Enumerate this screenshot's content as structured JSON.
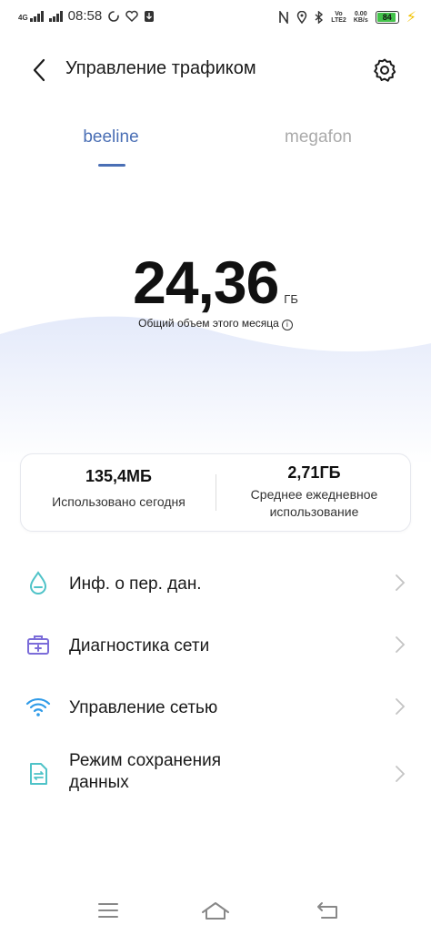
{
  "status_bar": {
    "network": "4G",
    "time": "08:58",
    "volte": "Vo‘\nLTE2",
    "speed": "0.00\nKB/s",
    "battery_level": "84",
    "battery_fraction": 0.84
  },
  "header": {
    "title": "Управление трафиком"
  },
  "tabs": [
    {
      "label": "beeline",
      "active": true
    },
    {
      "label": "megafon",
      "active": false
    }
  ],
  "usage": {
    "value": "24,36",
    "unit": "ГБ",
    "caption": "Общий объем этого месяца"
  },
  "stats": {
    "today_value": "135,4МБ",
    "today_label": "Использовано сегодня",
    "avg_value": "2,71ГБ",
    "avg_label_line1": "Среднее ежедневное",
    "avg_label_line2": "использование"
  },
  "menu": {
    "items": [
      {
        "label": "Инф. о пер. дан.",
        "icon": "drop-icon"
      },
      {
        "label": "Диагностика сети",
        "icon": "medkit-icon"
      },
      {
        "label": "Управление сетью",
        "icon": "wifi-icon"
      },
      {
        "label_line1": "Режим сохранения",
        "label_line2": "данных",
        "icon": "data-saver-icon"
      }
    ]
  },
  "colors": {
    "accent": "#4a6fb5",
    "wave": "#e9eefb",
    "icon_teal": "#4fc3c8",
    "icon_purple": "#7b6cd9",
    "icon_blue": "#2f9be8"
  }
}
